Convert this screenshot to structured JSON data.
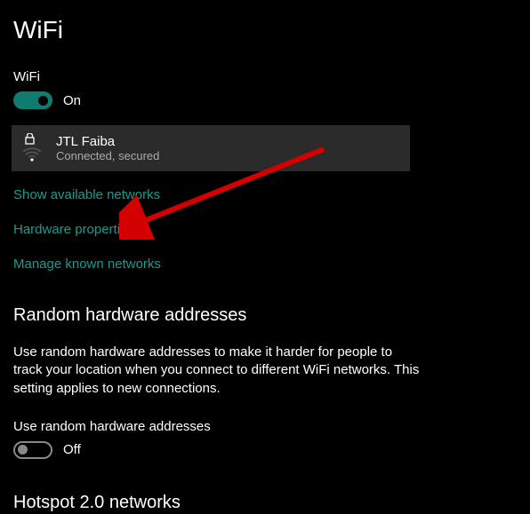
{
  "page": {
    "title": "WiFi"
  },
  "wifiSection": {
    "label": "WiFi",
    "toggleState": "On",
    "network": {
      "name": "JTL Faiba",
      "status": "Connected, secured"
    },
    "links": {
      "showNetworks": "Show available networks",
      "hardwareProps": "Hardware properties",
      "manageNetworks": "Manage known networks"
    }
  },
  "randomHw": {
    "heading": "Random hardware addresses",
    "description": "Use random hardware addresses to make it harder for people to track your location when you connect to different WiFi networks. This setting applies to new connections.",
    "toggleLabel": "Use random hardware addresses",
    "toggleState": "Off"
  },
  "hotspot": {
    "heading": "Hotspot 2.0 networks"
  },
  "colors": {
    "accent": "#107c6f",
    "link": "#1a9b8e"
  }
}
